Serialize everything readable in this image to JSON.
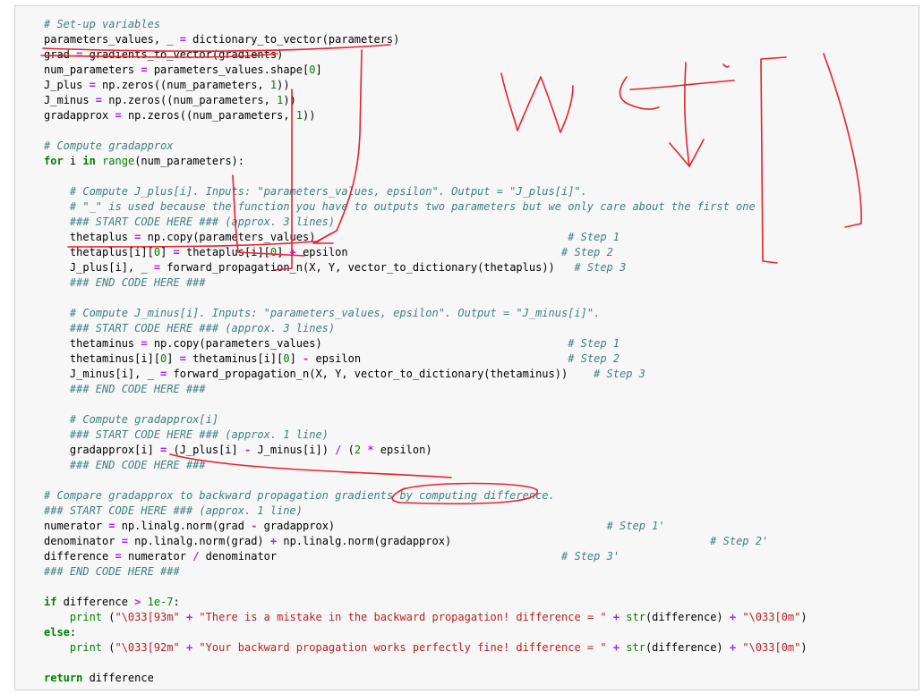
{
  "editor": {
    "lines": [
      "# Set-up variables",
      "parameters_values, _ = dictionary_to_vector(parameters)",
      "grad = gradients_to_vector(gradients)",
      "num_parameters = parameters_values.shape[0]",
      "J_plus = np.zeros((num_parameters, 1))",
      "J_minus = np.zeros((num_parameters, 1))",
      "gradapprox = np.zeros((num_parameters, 1))",
      "",
      "# Compute gradapprox",
      "for i in range(num_parameters):",
      "",
      "    # Compute J_plus[i]. Inputs: \"parameters_values, epsilon\". Output = \"J_plus[i]\".",
      "    # \"_\" is used because the function you have to outputs two parameters but we only care about the first one",
      "    ### START CODE HERE ### (approx. 3 lines)",
      "    thetaplus = np.copy(parameters_values)                                       # Step 1",
      "    thetaplus[i][0] = thetaplus[i][0] + epsilon                                 # Step 2",
      "    J_plus[i], _ = forward_propagation_n(X, Y, vector_to_dictionary(thetaplus))   # Step 3",
      "    ### END CODE HERE ###",
      "",
      "    # Compute J_minus[i]. Inputs: \"parameters_values, epsilon\". Output = \"J_minus[i]\".",
      "    ### START CODE HERE ### (approx. 3 lines)",
      "    thetaminus = np.copy(parameters_values)                                      # Step 1",
      "    thetaminus[i][0] = thetaminus[i][0] - epsilon                                # Step 2",
      "    J_minus[i], _ = forward_propagation_n(X, Y, vector_to_dictionary(thetaminus))    # Step 3",
      "    ### END CODE HERE ###",
      "",
      "    # Compute gradapprox[i]",
      "    ### START CODE HERE ### (approx. 1 line)",
      "    gradapprox[i] = (J_plus[i] - J_minus[i]) / (2 * epsilon)",
      "    ### END CODE HERE ###",
      "",
      "# Compare gradapprox to backward propagation gradients by computing difference.",
      "### START CODE HERE ### (approx. 1 line)",
      "numerator = np.linalg.norm(grad - gradapprox)                                          # Step 1'",
      "denominator = np.linalg.norm(grad) + np.linalg.norm(gradapprox)                                        # Step 2'",
      "difference = numerator / denominator                                            # Step 3'",
      "### END CODE HERE ###",
      "",
      "if difference > 1e-7:",
      "    print (\"\\033[93m\" + \"There is a mistake in the backward propagation! difference = \" + str(difference) + \"\\033[0m\")",
      "else:",
      "    print (\"\\033[92m\" + \"Your backward propagation works perfectly fine! difference = \" + str(difference) + \"\\033[0m\")",
      "",
      "return difference"
    ]
  },
  "colors": {
    "cell_background": "#f7f7f7",
    "cell_border": "#cfcfcf",
    "comment": "#408080",
    "keyword": "#008000",
    "string": "#ba2121",
    "number": "#008000",
    "operator": "#aa22ff",
    "ink": "#e8222c"
  }
}
